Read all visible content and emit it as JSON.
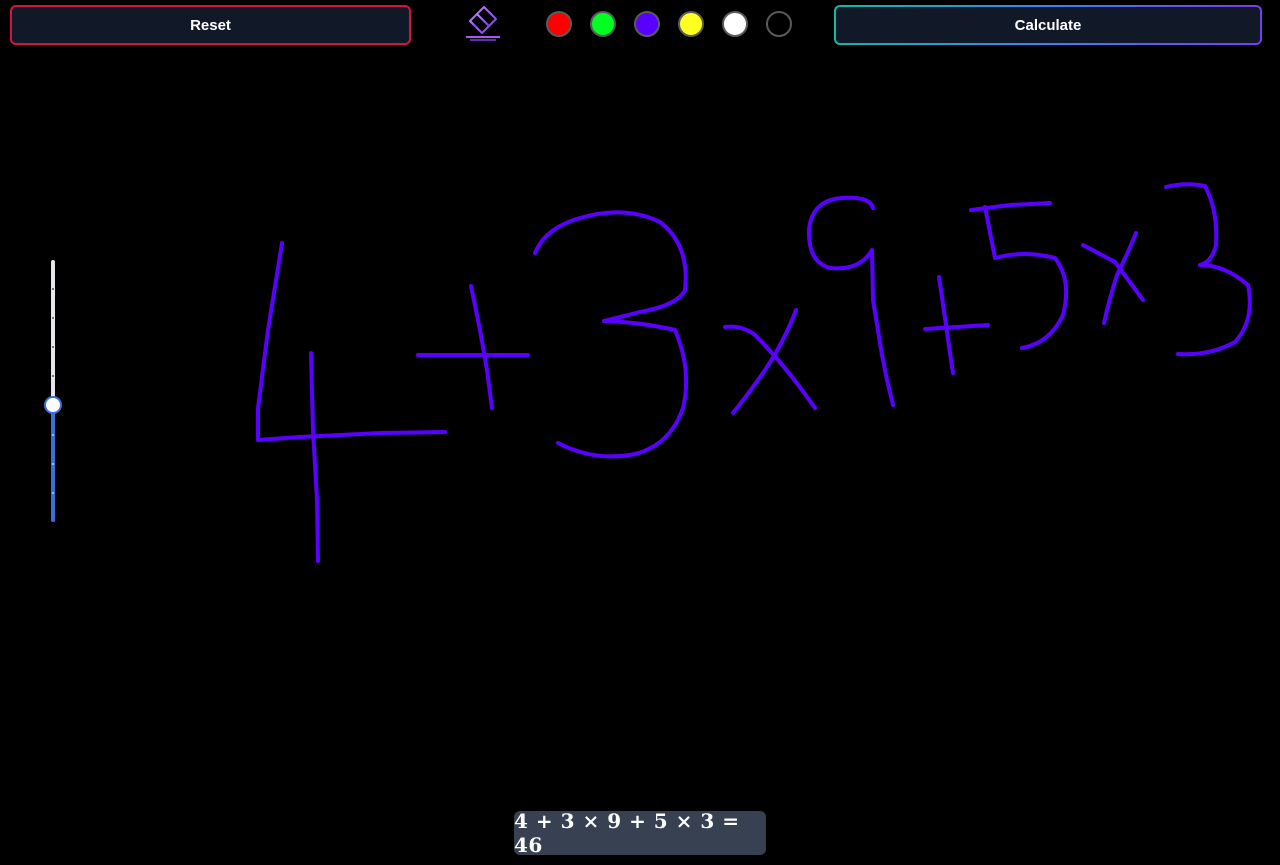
{
  "toolbar": {
    "reset_label": "Reset",
    "calculate_label": "Calculate",
    "eraser_icon": "eraser-icon",
    "colors": [
      "#ff0000",
      "#00ff22",
      "#5a00ff",
      "#ffff22",
      "#ffffff",
      "#000000"
    ],
    "selected_color": "#5a00ff"
  },
  "brush": {
    "size_level": 0.5
  },
  "result": {
    "text": "4 + 3 × 9 + 5 × 3 = 46"
  }
}
